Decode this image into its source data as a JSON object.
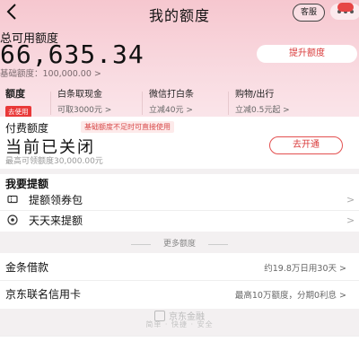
{
  "header": {
    "title": "我的额度",
    "kefu_label": "客服"
  },
  "summary": {
    "available_label": "总可用额度",
    "available_amount": "66,635.34",
    "base_text": "基础额度：100,000.00 >",
    "raise_button": "提升额度"
  },
  "tabs": [
    {
      "title": "额度",
      "badge": "去使用"
    },
    {
      "title": "白条取现金",
      "sub": "可取3000元 >"
    },
    {
      "title": "微信打白条",
      "sub": "立减40元 >"
    },
    {
      "title": "购物/出行",
      "sub": "立减0.5元起 >"
    }
  ],
  "paid": {
    "title": "付费额度",
    "tip": "基础额度不足时可直接使用",
    "status": "当前已关闭",
    "max_text": "最高可领额度30,000.00元",
    "open_button": "去开通"
  },
  "raise": {
    "title": "我要提额",
    "items": [
      {
        "label": "提额领券包",
        "icon": "coupon-icon"
      },
      {
        "label": "天天来提额",
        "icon": "target-icon"
      }
    ]
  },
  "more": {
    "heading": "更多额度",
    "items": [
      {
        "label": "金条借款",
        "desc": "约19.8万日用30天 >"
      },
      {
        "label": "京东联名信用卡",
        "desc": "最高10万额度，分期0利息 >"
      }
    ]
  },
  "footer": {
    "brand": "京东金融",
    "slogan": "简单 · 快捷 · 安全"
  },
  "colors": {
    "accent": "#e23b3b",
    "hero_top": "#f6c7cf",
    "hero_bottom": "#fbe9ed"
  }
}
